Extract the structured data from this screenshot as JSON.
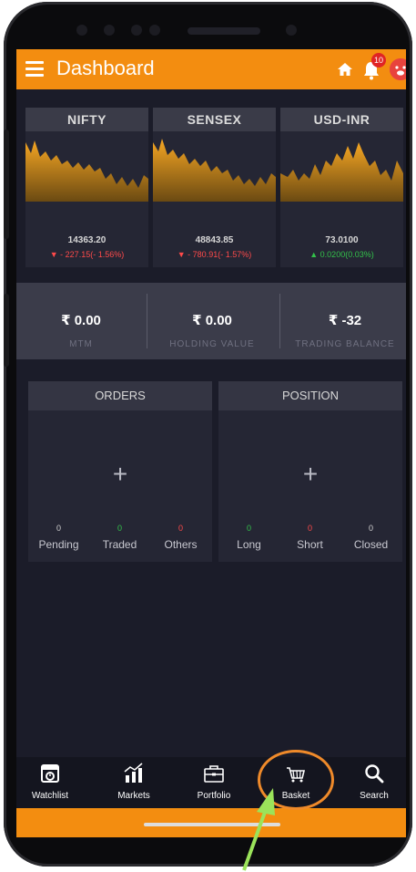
{
  "header": {
    "title": "Dashboard",
    "notification_count": "10"
  },
  "indices": [
    {
      "name": "NIFTY",
      "value": "14363.20",
      "change": "▼ - 227.15(- 1.56%)",
      "direction": "down"
    },
    {
      "name": "SENSEX",
      "value": "48843.85",
      "change": "▼ - 780.91(- 1.57%)",
      "direction": "down"
    },
    {
      "name": "USD-INR",
      "value": "73.0100",
      "change": "▲ 0.0200(0.03%)",
      "direction": "up"
    }
  ],
  "balances": [
    {
      "value": "₹ 0.00",
      "label": "MTM"
    },
    {
      "value": "₹ 0.00",
      "label": "HOLDING VALUE"
    },
    {
      "value": "₹ -32",
      "label": "TRADING BALANCE"
    }
  ],
  "orders": {
    "title": "ORDERS",
    "stats": [
      {
        "count": "0",
        "label": "Pending"
      },
      {
        "count": "0",
        "label": "Traded"
      },
      {
        "count": "0",
        "label": "Others"
      }
    ]
  },
  "position": {
    "title": "POSITION",
    "stats": [
      {
        "count": "0",
        "label": "Long"
      },
      {
        "count": "0",
        "label": "Short"
      },
      {
        "count": "0",
        "label": "Closed"
      }
    ]
  },
  "nav": [
    {
      "label": "Watchlist",
      "icon": "watchlist-icon"
    },
    {
      "label": "Markets",
      "icon": "markets-icon"
    },
    {
      "label": "Portfolio",
      "icon": "portfolio-icon"
    },
    {
      "label": "Basket",
      "icon": "basket-icon"
    },
    {
      "label": "Search",
      "icon": "search-icon"
    }
  ],
  "colors": {
    "accent": "#f38d10",
    "background": "#1b1c29",
    "negative": "#ff4a4a",
    "positive": "#33c24a",
    "annotation_circle": "#ef8a2a",
    "annotation_arrow": "#9be35a"
  }
}
